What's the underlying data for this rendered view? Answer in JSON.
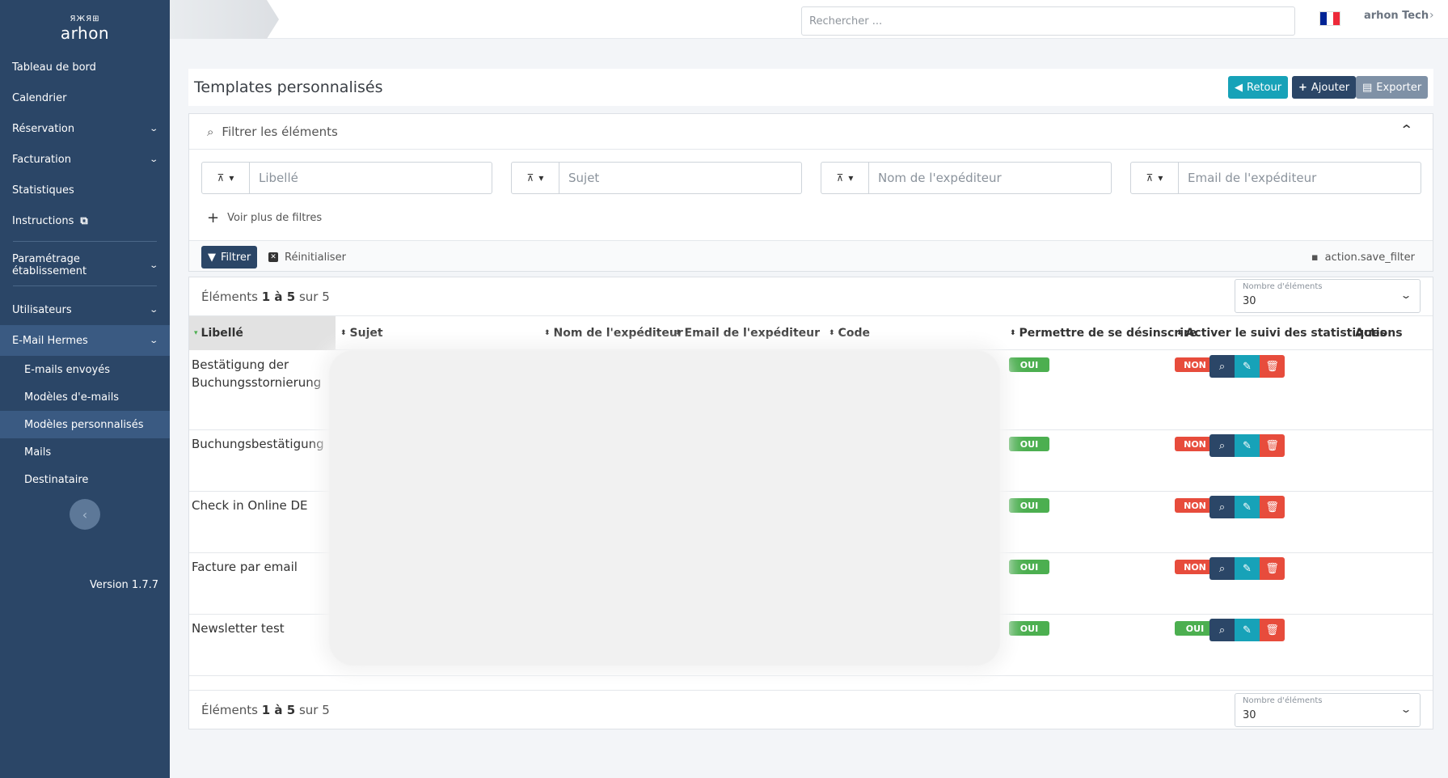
{
  "sidebar": {
    "logo_glyphs": "ЯЖЯ⊞",
    "logo_text": "arhon",
    "items": [
      {
        "label": "Tableau de bord"
      },
      {
        "label": "Calendrier"
      },
      {
        "label": "Réservation"
      },
      {
        "label": "Facturation"
      },
      {
        "label": "Statistiques"
      },
      {
        "label": "Instructions"
      }
    ],
    "settings_label": "Paramétrage établissement",
    "users_label": "Utilisateurs",
    "hermes_label": "E-Mail Hermes",
    "sub_items": [
      {
        "label": "E-mails envoyés"
      },
      {
        "label": "Modèles d'e-mails"
      },
      {
        "label": "Modèles personnalisés"
      },
      {
        "label": "Mails"
      },
      {
        "label": "Destinataire"
      }
    ],
    "version": "Version 1.7.7"
  },
  "topbar": {
    "search_placeholder": "Rechercher ...",
    "flag_colors": [
      "#002395",
      "#ffffff",
      "#ed2939"
    ],
    "user": "arhon Tech"
  },
  "header": {
    "title": "Templates personnalisés",
    "btn_retour": "Retour",
    "btn_ajouter": "Ajouter",
    "btn_exporter": "Exporter"
  },
  "filters": {
    "title": "Filtrer les éléments",
    "fields": [
      {
        "placeholder": "Libellé"
      },
      {
        "placeholder": "Sujet"
      },
      {
        "placeholder": "Nom de l'expéditeur"
      },
      {
        "placeholder": "Email de l'expéditeur"
      }
    ],
    "more": "Voir plus de filtres",
    "btn_filter": "Filtrer",
    "btn_reset": "Réinitialiser",
    "save_filter": "action.save_filter"
  },
  "table": {
    "count_prefix": "Éléments",
    "count_range": "1 à 5",
    "count_suffix": "sur 5",
    "page_size_label": "Nombre d'éléments",
    "page_size_value": "30",
    "columns": [
      {
        "label": "Libellé"
      },
      {
        "label": "Sujet"
      },
      {
        "label": "Nom de l'expéditeur"
      },
      {
        "label": "Email de l'expéditeur"
      },
      {
        "label": "Code"
      },
      {
        "label": "Permettre de se désinscrire"
      },
      {
        "label": "Activer le suivi des statistiques"
      },
      {
        "label": "Actions"
      }
    ],
    "rows": [
      {
        "label": "Bestätigung der Buchungsstornierung",
        "unsubscribe": "OUI",
        "stats": "NON"
      },
      {
        "label": "Buchungsbestätigung",
        "unsubscribe": "OUI",
        "stats": "NON"
      },
      {
        "label": "Check in Online DE",
        "unsubscribe": "OUI",
        "stats": "NON"
      },
      {
        "label": "Facture par email",
        "unsubscribe": "OUI",
        "stats": "NON"
      },
      {
        "label": "Newsletter test",
        "unsubscribe": "OUI",
        "stats": "OUI"
      }
    ]
  }
}
